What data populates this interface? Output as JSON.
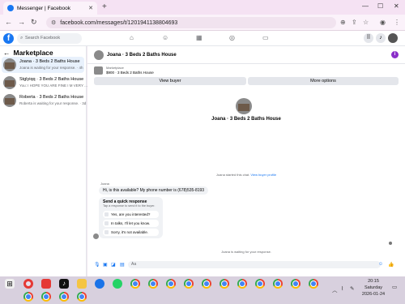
{
  "browser": {
    "tab_title": "Messenger | Facebook",
    "url": "facebook.com/messages/t/1201941138804693"
  },
  "fb_header": {
    "search_placeholder": "Search Facebook"
  },
  "sidebar": {
    "title": "Marketplace",
    "conversations": [
      {
        "name": "Joana · 3 Beds 2 Baths House",
        "preview": "Joana is waiting for your response. · 4h",
        "time": ""
      },
      {
        "name": "Stglyiqq · 3 Beds 2 Baths House",
        "preview": "You: I HOPE YOU ARE FINE I M VERY ...",
        "time": "· 2d"
      },
      {
        "name": "Roberta · 3 Beds 2 Baths House",
        "preview": "Roberta is waiting for your response. · 3d",
        "time": ""
      }
    ]
  },
  "chat": {
    "header_title": "Joana · 3 Beds 2 Baths House",
    "listing_type": "Marketplace",
    "listing_price": "$900 · 3 Beds 2 Baths House",
    "view_buyer_label": "View buyer",
    "more_options_label": "More options",
    "center_name": "Joana · 3 Beds 2 Baths House",
    "started_text": "Joana started this chat.",
    "view_profile_link": "View buyer profile",
    "sender_label": "Joana",
    "message": "Hi, is this available? My phone number is (678)535-8193",
    "quick_title": "Send a quick response",
    "quick_subtitle": "Tap a response to send it to the buyer.",
    "quick_replies": [
      "Yes, are you interested?",
      "In talks, I'll let you know.",
      "Sorry, it's not available."
    ],
    "waiting_text": "Joana is waiting for your response.",
    "composer_placeholder": "Aa"
  },
  "taskbar": {
    "time": "20:15",
    "day": "Saturday",
    "date": "2026-01-24"
  }
}
